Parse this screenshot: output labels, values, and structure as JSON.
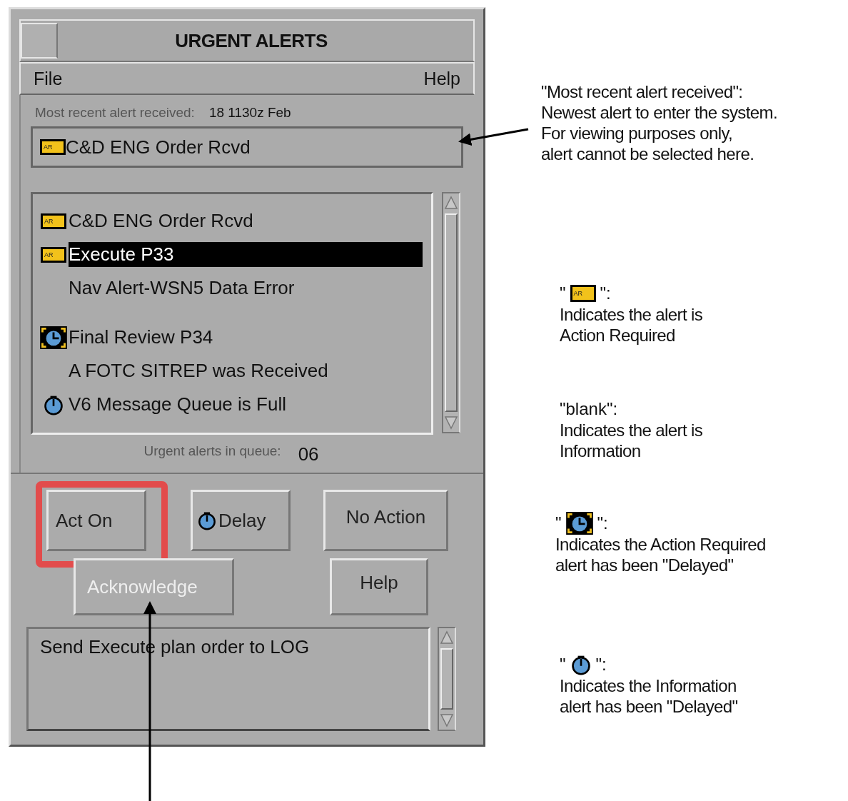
{
  "window": {
    "title": "URGENT ALERTS",
    "menu": [
      "File",
      "Help"
    ]
  },
  "recent": {
    "label": "Most recent alert received:",
    "time": "18 1130z  Feb",
    "alert": {
      "text": "C&D ENG Order Rcvd",
      "kind": "action",
      "badge": "AR"
    }
  },
  "alerts": [
    {
      "text": "C&D ENG Order Rcvd",
      "kind": "action",
      "badge": "AR",
      "selected": false
    },
    {
      "text": "Execute P33",
      "kind": "action",
      "badge": "AR",
      "selected": true
    },
    {
      "text": "Nav Alert-WSN5 Data Error",
      "kind": "info",
      "selected": false
    },
    {
      "text": "Final Review P34",
      "kind": "action_delayed",
      "selected": false
    },
    {
      "text": "A FOTC SITREP was Received",
      "kind": "info",
      "selected": false
    },
    {
      "text": "V6 Message Queue is Full",
      "kind": "info_delayed",
      "selected": false
    }
  ],
  "queue": {
    "label": "Urgent alerts in queue:",
    "count": "06"
  },
  "button_rows": [
    [
      {
        "label": "Act On",
        "kind": "plain",
        "disabled": false,
        "highlighted": true
      },
      {
        "label": "Delay",
        "kind": "delay",
        "disabled": false,
        "highlighted": false
      },
      {
        "label": "No Action",
        "kind": "plain",
        "disabled": false,
        "highlighted": false
      }
    ],
    [
      {
        "label": "Acknowledge",
        "kind": "plain",
        "disabled": true,
        "highlighted": false
      },
      {
        "label": "Help",
        "kind": "plain",
        "disabled": false,
        "highlighted": false
      }
    ]
  ],
  "message": "Send Execute plan order to LOG",
  "annotations": {
    "recent_note": "\"Most recent alert received\":\nNewest alert to enter the system.\nFor viewing purposes only,\nalert cannot be selected here.",
    "legend": [
      {
        "kind": "action",
        "badge": "AR",
        "prefix": "\"",
        "suffix": "\":",
        "text": "Indicates the alert is\nAction Required"
      },
      {
        "kind": "info",
        "prefix": "\"blank\":",
        "text": "Indicates the alert is\nInformation"
      },
      {
        "kind": "action_delayed",
        "prefix": "\"",
        "suffix": "\":",
        "text": "Indicates the Action Required\nalert has been \"Delayed\""
      },
      {
        "kind": "info_delayed",
        "prefix": "\"",
        "suffix": "\":",
        "text": "Indicates the Information\nalert has been \"Delayed\""
      }
    ]
  }
}
